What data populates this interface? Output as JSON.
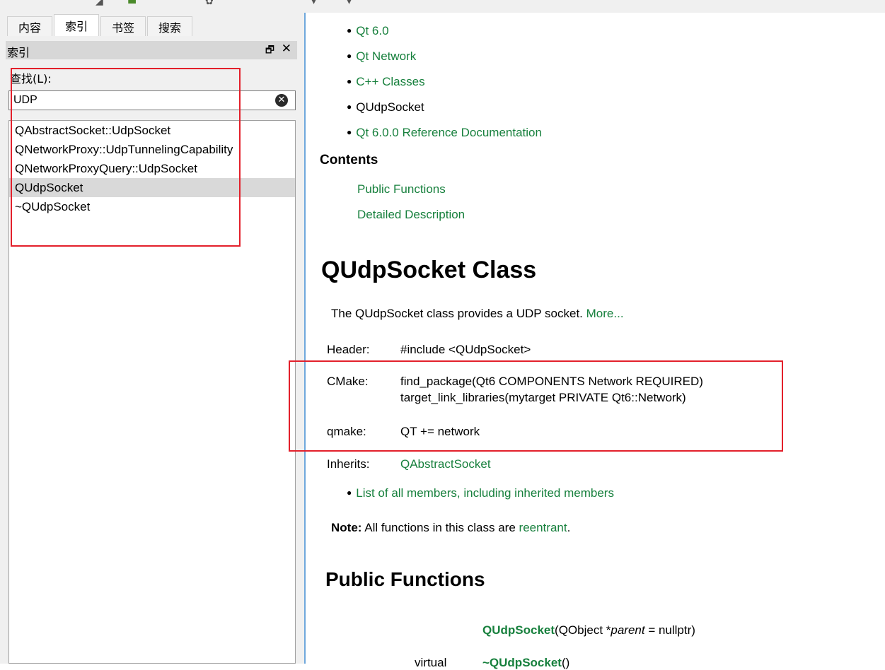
{
  "left_pane": {
    "tabs": [
      {
        "label": "内容",
        "active": false
      },
      {
        "label": "索引",
        "active": true
      },
      {
        "label": "书签",
        "active": false
      },
      {
        "label": "搜索",
        "active": false
      }
    ],
    "dock_title": "索引",
    "float_icon": "float-window-icon",
    "close_icon": "close-icon",
    "find_label": "查找(L):",
    "search_value": "UDP",
    "clear_icon": "clear-input-icon",
    "results": [
      {
        "label": "QAbstractSocket::UdpSocket",
        "selected": false
      },
      {
        "label": "QNetworkProxy::UdpTunnelingCapability",
        "selected": false
      },
      {
        "label": "QNetworkProxyQuery::UdpSocket",
        "selected": false
      },
      {
        "label": "QUdpSocket",
        "selected": true
      },
      {
        "label": "~QUdpSocket",
        "selected": false
      }
    ]
  },
  "content": {
    "breadcrumbs": [
      {
        "label": "Qt 6.0",
        "link": true
      },
      {
        "label": "Qt Network",
        "link": true
      },
      {
        "label": "C++ Classes",
        "link": true
      },
      {
        "label": "QUdpSocket",
        "link": false
      },
      {
        "label": "Qt 6.0.0 Reference Documentation",
        "link": true
      }
    ],
    "contents_heading": "Contents",
    "toc": [
      "Public Functions",
      "Detailed Description"
    ],
    "class_title": "QUdpSocket Class",
    "brief": "The QUdpSocket class provides a UDP socket.",
    "brief_more": "More...",
    "header_key": "Header:",
    "header_val": "#include <QUdpSocket>",
    "cmake_key": "CMake:",
    "cmake_line1": "find_package(Qt6 COMPONENTS Network REQUIRED)",
    "cmake_line2": "target_link_libraries(mytarget PRIVATE Qt6::Network)",
    "qmake_key": "qmake:",
    "qmake_val": "QT += network",
    "inherits_key": "Inherits:",
    "inherits_val": "QAbstractSocket",
    "all_members": "List of all members, including inherited members",
    "note_label": "Note:",
    "note_text": "All functions in this class are",
    "note_link": "reentrant",
    "note_end": ".",
    "public_functions_title": "Public Functions",
    "ctor_name": "QUdpSocket",
    "ctor_args_open": "(QObject *",
    "ctor_param": "parent",
    "ctor_args_close": " = nullptr)",
    "dtor_prefix": "virtual",
    "dtor_name": "~QUdpSocket",
    "dtor_args": "()"
  },
  "colors": {
    "link": "#17803d",
    "highlight_box": "#e3202b",
    "selected_row": "#d9d9d9",
    "splitter": "#6fa8dc"
  }
}
